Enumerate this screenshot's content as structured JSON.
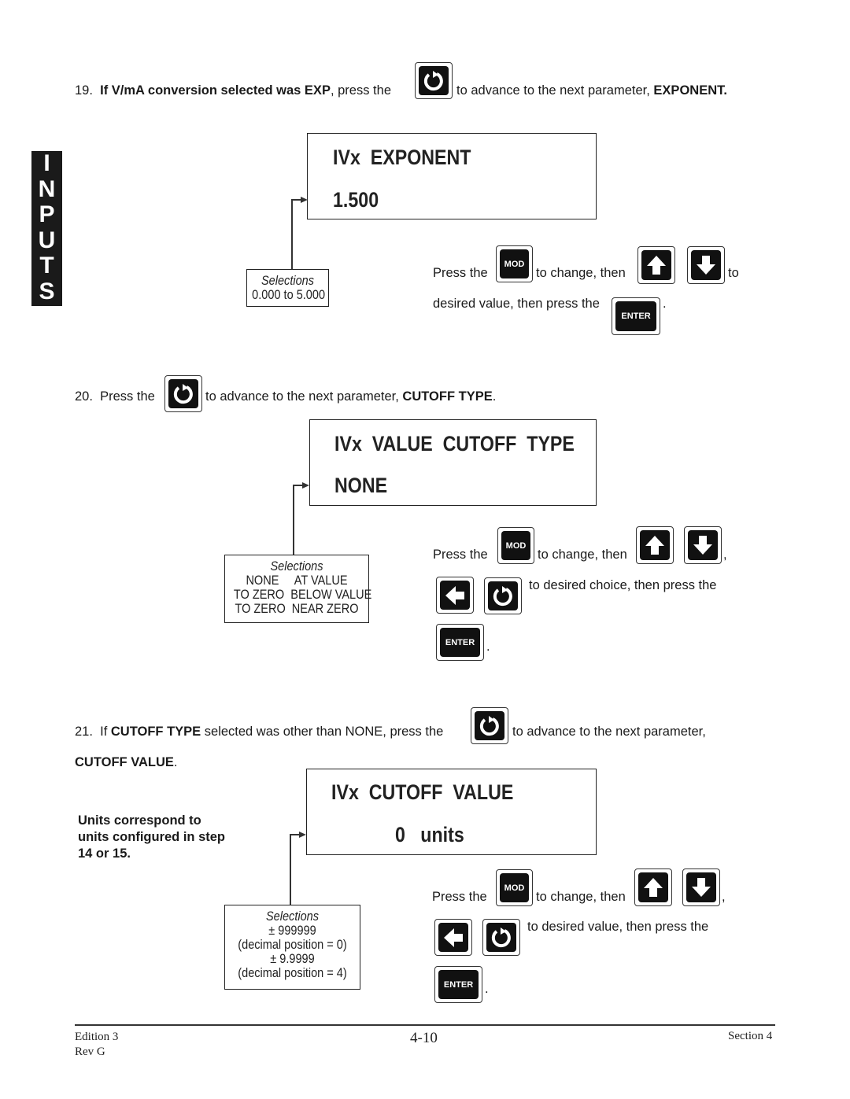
{
  "side_tab": {
    "letters": [
      "I",
      "N",
      "P",
      "U",
      "T",
      "S"
    ]
  },
  "step19": {
    "num": "19.",
    "bold_lead": "If V/mA conversion selected was EXP",
    "mid": ", press the",
    "tail": "to advance to the next parameter,",
    "param": "EXPONENT."
  },
  "display1": {
    "line1": "IVx  EXPONENT",
    "line2": "1.500"
  },
  "selections1": {
    "title": "Selections",
    "lines": [
      "0.000 to 5.000"
    ]
  },
  "instr1": {
    "press_the": "Press  the",
    "to_change_then": "to  change,  then",
    "to": "to",
    "desired": "desired value, then press the",
    "period": "."
  },
  "step20": {
    "num": "20.",
    "lead": "Press the",
    "tail": "to advance to the next parameter,",
    "param": "CUTOFF TYPE",
    "period": "."
  },
  "display2": {
    "line1": "IVx  VALUE  CUTOFF  TYPE",
    "line2": "NONE"
  },
  "selections2": {
    "title": "Selections",
    "lines": [
      "NONE     AT VALUE",
      "TO ZERO  BELOW VALUE",
      "TO ZERO  NEAR ZERO"
    ]
  },
  "instr2": {
    "press_the": "Press  the",
    "to_change_then": "to change, then",
    "comma": ",",
    "desired": "to desired choice, then press the",
    "period": "."
  },
  "step21": {
    "num": "21.",
    "lead": "If",
    "bold1": "CUTOFF TYPE",
    "mid": "selected was other than NONE, press the",
    "tail": "to advance to the next parameter,",
    "param": "CUTOFF VALUE",
    "period": "."
  },
  "units_note": {
    "lines": [
      "Units correspond to",
      "units configured in step",
      "14 or 15."
    ]
  },
  "display3": {
    "line1": "IVx  CUTOFF  VALUE",
    "line2": "0   units"
  },
  "selections3": {
    "title": "Selections",
    "lines": [
      "± 999999",
      "(decimal position = 0)",
      "± 9.9999",
      "(decimal position = 4)"
    ]
  },
  "instr3": {
    "press_the": "Press  the",
    "to_change_then": "to change, then",
    "comma": ",",
    "desired": "to desired value, then press the",
    "period": "."
  },
  "keys": {
    "mod": "MOD",
    "enter": "ENTER"
  },
  "footer": {
    "edition": "Edition 3",
    "rev": "Rev G",
    "page": "4-10",
    "section": "Section 4"
  }
}
